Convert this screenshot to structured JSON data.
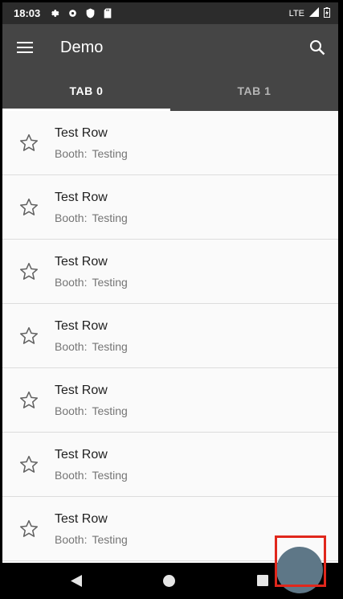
{
  "status_bar": {
    "time": "18:03",
    "network": "LTE",
    "icons": [
      "gear-icon",
      "gear-icon",
      "shield-icon",
      "sd-card-icon",
      "signal-icon",
      "battery-icon"
    ]
  },
  "app_bar": {
    "title": "Demo",
    "menu_icon": "menu-icon",
    "search_icon": "search-icon"
  },
  "tabs": [
    {
      "label": "TAB 0",
      "selected": true
    },
    {
      "label": "TAB 1",
      "selected": false
    }
  ],
  "rows": [
    {
      "title": "Test Row",
      "sub_label": "Booth:",
      "sub_value": "Testing",
      "icon": "star-outline-icon"
    },
    {
      "title": "Test Row",
      "sub_label": "Booth:",
      "sub_value": "Testing",
      "icon": "star-outline-icon"
    },
    {
      "title": "Test Row",
      "sub_label": "Booth:",
      "sub_value": "Testing",
      "icon": "star-outline-icon"
    },
    {
      "title": "Test Row",
      "sub_label": "Booth:",
      "sub_value": "Testing",
      "icon": "star-outline-icon"
    },
    {
      "title": "Test Row",
      "sub_label": "Booth:",
      "sub_value": "Testing",
      "icon": "star-outline-icon"
    },
    {
      "title": "Test Row",
      "sub_label": "Booth:",
      "sub_value": "Testing",
      "icon": "star-outline-icon"
    },
    {
      "title": "Test Row",
      "sub_label": "Booth:",
      "sub_value": "Testing",
      "icon": "star-outline-icon"
    }
  ],
  "colors": {
    "app_bar": "#454545",
    "status_bar": "#2c2c2c",
    "fab": "#5e7787",
    "highlight_box": "#e0271c"
  },
  "nav_bar": {
    "icons": [
      "back-icon",
      "home-icon",
      "recents-icon"
    ]
  }
}
